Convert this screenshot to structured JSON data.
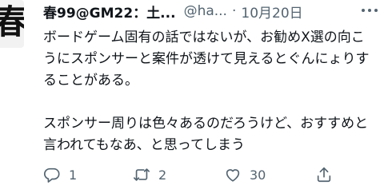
{
  "tweet": {
    "author_name": "春99@GM22：土...",
    "handle": "@ha...",
    "separator": "·",
    "date": "10月20日",
    "avatar_glyph": "春",
    "paragraphs": [
      "ボードゲーム固有の話ではないが、お勧めX選の向こうにスポンサーと案件が透けて見えるとぐんにょりすることがある。",
      "スポンサー周りは色々あるのだろうけど、おすすめと言われてもなあ、と思ってしまう"
    ],
    "actions": {
      "reply": {
        "icon": "reply-icon",
        "count": "1"
      },
      "retweet": {
        "icon": "retweet-icon",
        "count": "2"
      },
      "like": {
        "icon": "heart-icon",
        "count": "30"
      },
      "share": {
        "icon": "share-icon"
      }
    },
    "colors": {
      "text": "#0f1419",
      "secondary": "#536471"
    }
  }
}
